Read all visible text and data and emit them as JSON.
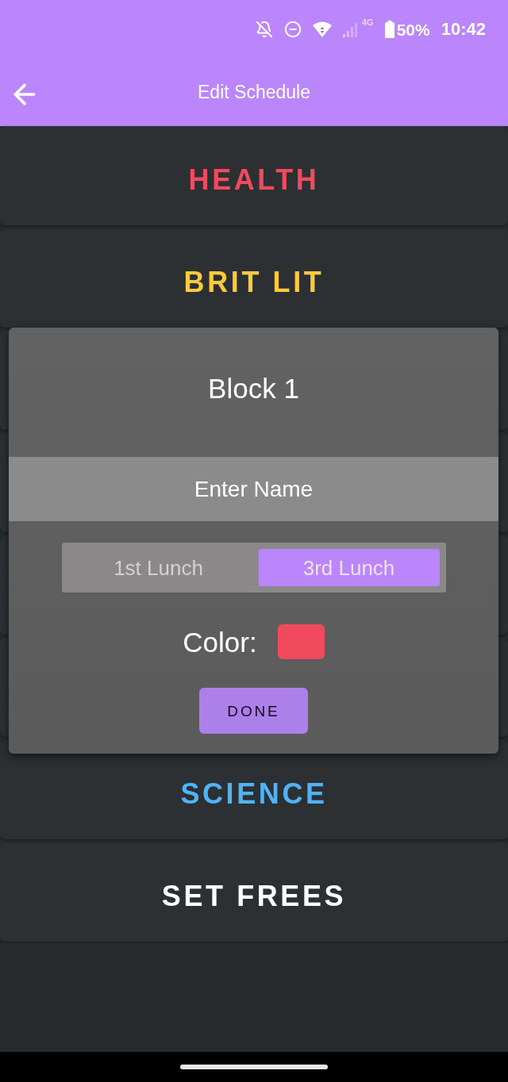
{
  "status_bar": {
    "network": "4G",
    "battery": "50%",
    "time": "10:42"
  },
  "toolbar": {
    "title": "Edit Schedule"
  },
  "blocks": [
    {
      "name": "HEALTH",
      "color": "#f04a5e"
    },
    {
      "name": "BRIT LIT",
      "color": "#fcca3e"
    },
    {
      "name": "SCIENCE",
      "color": "#4fb3f6"
    },
    {
      "name": "SET FREES",
      "color": "#ffffff"
    }
  ],
  "dialog": {
    "title": "Block 1",
    "name_field": {
      "placeholder": "Enter Name"
    },
    "lunch_options": [
      {
        "label": "1st Lunch",
        "selected": false
      },
      {
        "label": "3rd Lunch",
        "selected": true
      }
    ],
    "color_label": "Color:",
    "color": "#f04a5e",
    "button": "DONE"
  }
}
